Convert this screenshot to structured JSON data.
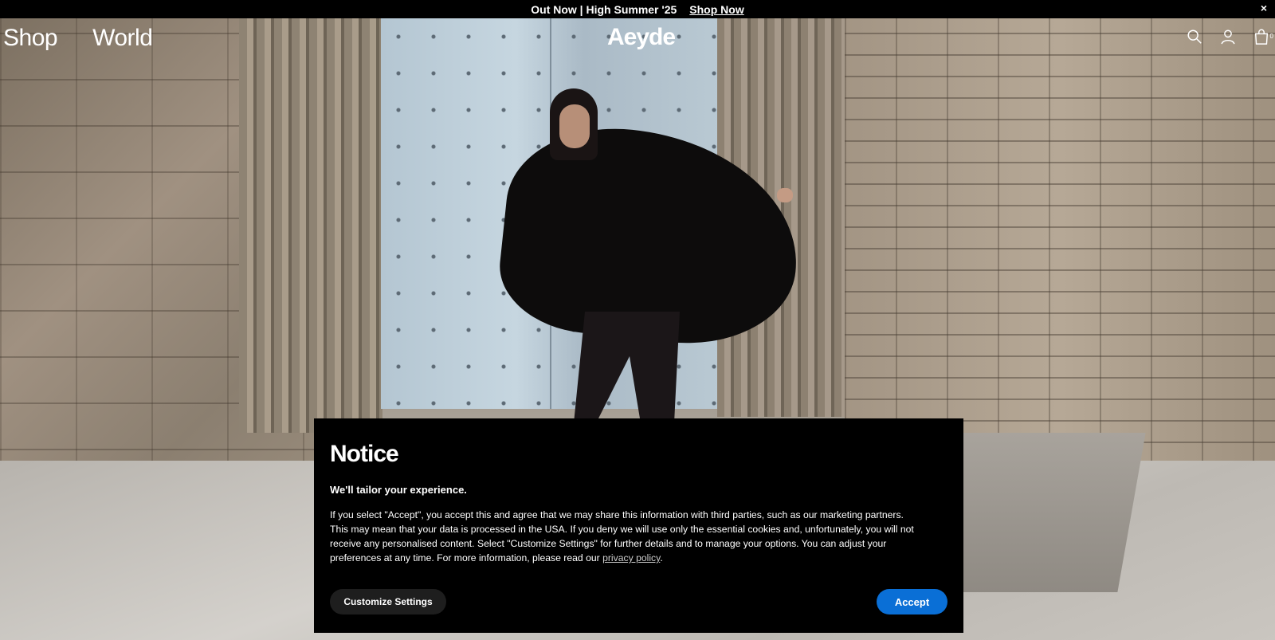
{
  "announcement": {
    "text": "Out Now | High Summer '25",
    "link_label": "Shop Now",
    "close_glyph": "×"
  },
  "nav": {
    "items": [
      {
        "label": "Shop"
      },
      {
        "label": "World"
      }
    ],
    "logo": "Aeyde",
    "icons": [
      "search-icon",
      "account-icon",
      "cart-icon"
    ],
    "cart_count": "0"
  },
  "notice": {
    "title": "Notice",
    "subtitle": "We'll tailor your experience.",
    "body": "If you select \"Accept\", you accept this and agree that we may share this information with third parties, such as our marketing partners. This may mean that your data is processed in the USA. If you deny we will use only the essential cookies and, unfortunately, you will not receive any personalised content. Select \"Customize Settings\" for further details and to manage your options. You can adjust your preferences at any time. For more information, please read our ",
    "privacy_link": "privacy policy",
    "body_end": ".",
    "customize_label": "Customize Settings",
    "accept_label": "Accept",
    "accept_color": "#0a6fd6"
  }
}
